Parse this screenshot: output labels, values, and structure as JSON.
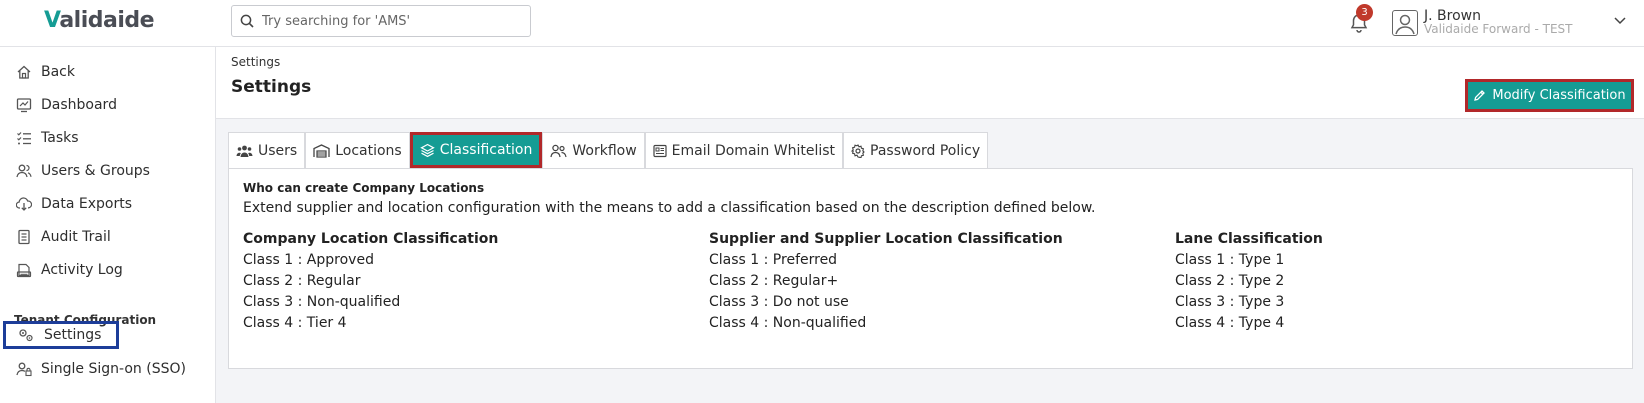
{
  "brand": {
    "logo_v": "V",
    "logo_rest": "alidaide"
  },
  "search": {
    "placeholder": "Try searching for 'AMS'"
  },
  "notifications": {
    "count": "3"
  },
  "user": {
    "name": "J. Brown",
    "org": "Validaide Forward - TEST"
  },
  "sidebar": {
    "items": [
      {
        "label": "Back",
        "icon": "home-icon"
      },
      {
        "label": "Dashboard",
        "icon": "dashboard-icon"
      },
      {
        "label": "Tasks",
        "icon": "tasks-icon"
      },
      {
        "label": "Users & Groups",
        "icon": "users-icon"
      },
      {
        "label": "Data Exports",
        "icon": "download-icon"
      },
      {
        "label": "Audit Trail",
        "icon": "audit-icon"
      },
      {
        "label": "Activity Log",
        "icon": "activity-icon"
      }
    ],
    "section_title": "Tenant Configuration",
    "config_items": [
      {
        "label": "Settings",
        "icon": "gears-icon"
      },
      {
        "label": "Single Sign-on (SSO)",
        "icon": "user-lock-icon"
      }
    ]
  },
  "page": {
    "breadcrumb": "Settings",
    "title": "Settings"
  },
  "actions": {
    "modify_label": "Modify Classification"
  },
  "tabs": [
    {
      "label": "Users",
      "icon": "users-icon"
    },
    {
      "label": "Locations",
      "icon": "warehouse-icon"
    },
    {
      "label": "Classification",
      "icon": "layers-icon",
      "active": true
    },
    {
      "label": "Workflow",
      "icon": "user-flow-icon"
    },
    {
      "label": "Email Domain Whitelist",
      "icon": "list-icon"
    },
    {
      "label": "Password Policy",
      "icon": "gear-icon"
    }
  ],
  "panel": {
    "heading": "Who can create Company Locations",
    "description": "Extend supplier and location configuration with the means to add a classification based on the description defined below.",
    "columns": [
      {
        "title": "Company Location Classification",
        "rows": [
          "Class 1 : Approved",
          "Class 2 : Regular",
          "Class 3 : Non-qualified",
          "Class 4 : Tier 4"
        ]
      },
      {
        "title": "Supplier and Supplier Location Classification",
        "rows": [
          "Class 1 : Preferred",
          "Class 2 : Regular+",
          "Class 3 : Do not use",
          "Class 4 : Non-qualified"
        ]
      },
      {
        "title": "Lane Classification",
        "rows": [
          "Class 1 : Type 1",
          "Class 2 : Type 2",
          "Class 3 : Type 3",
          "Class 4 : Type 4"
        ]
      }
    ]
  },
  "colors": {
    "accent": "#159c94",
    "highlight_red": "#b2282a",
    "highlight_blue": "#1d3d99",
    "badge": "#c0392b"
  }
}
